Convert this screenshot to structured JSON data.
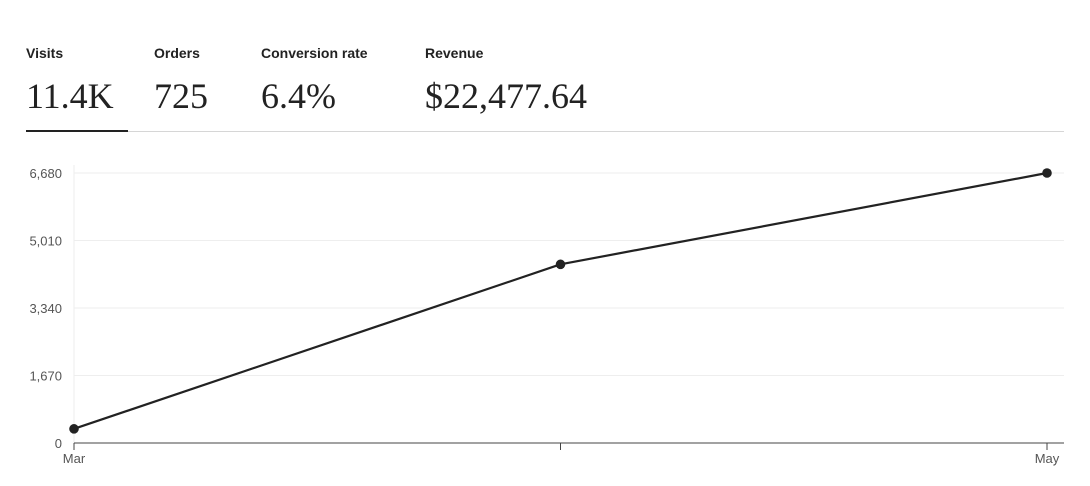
{
  "metrics": [
    {
      "label": "Visits",
      "value": "11.4K",
      "active": true
    },
    {
      "label": "Orders",
      "value": "725",
      "active": false
    },
    {
      "label": "Conversion rate",
      "value": "6.4%",
      "active": false
    },
    {
      "label": "Revenue",
      "value": "$22,477.64",
      "active": false
    }
  ],
  "colors": {
    "line": "#222222",
    "axis": "#444444",
    "grid": "#eeeeee",
    "active_tab": "#222222"
  },
  "chart_data": {
    "type": "line",
    "categories": [
      "Mar",
      "",
      "May"
    ],
    "series": [
      {
        "values": [
          350,
          4420,
          6680
        ]
      }
    ],
    "yticks": [
      "0",
      "1,670",
      "3,340",
      "5,010",
      "6,680"
    ],
    "ylim": [
      0,
      6680
    ],
    "grid": true,
    "markers": true
  }
}
